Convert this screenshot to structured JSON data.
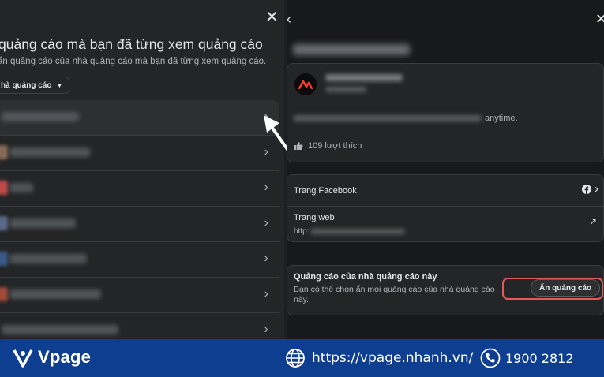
{
  "left_panel": {
    "title": "quảng cáo mà bạn đã từng xem quảng cáo",
    "subtitle": "ẩn quảng cáo của nhà quảng cáo mà bạn đã từng xem quảng cáo.",
    "filter_label": "hà quảng cáo",
    "close_icon": "close-icon",
    "advertisers": [
      {
        "selected": true,
        "thumb_color": "#3b3d40"
      },
      {
        "selected": false,
        "thumb_color": "#8a6b5a"
      },
      {
        "selected": false,
        "thumb_color": "#c04a4a"
      },
      {
        "selected": false,
        "thumb_color": "#5a6b8a"
      },
      {
        "selected": false,
        "thumb_color": "#3a5a8a"
      },
      {
        "selected": false,
        "thumb_color": "#a04a3a"
      },
      {
        "selected": false,
        "thumb_color": "#5a5d61"
      }
    ]
  },
  "right_panel": {
    "profile": {
      "description_tail": "anytime.",
      "likes": "109 lượt thích"
    },
    "links": {
      "facebook_label": "Trang Facebook",
      "web_label": "Trang web",
      "web_url_prefix": "http:"
    },
    "hide_section": {
      "title": "Quảng cáo của nhà quảng cáo này",
      "description": "Bạn có thể chọn ẩn mọi quảng cáo của nhà quảng cáo này.",
      "button_label": "Ẩn quảng cáo"
    }
  },
  "banner": {
    "brand": "Vpage",
    "website": "https://vpage.nhanh.vn/",
    "phone": "1900 2812",
    "background": "#0d3e90"
  },
  "colors": {
    "highlight": "#e05a5a",
    "panel": "#242526",
    "accent_logo": "#ff3b2f"
  }
}
